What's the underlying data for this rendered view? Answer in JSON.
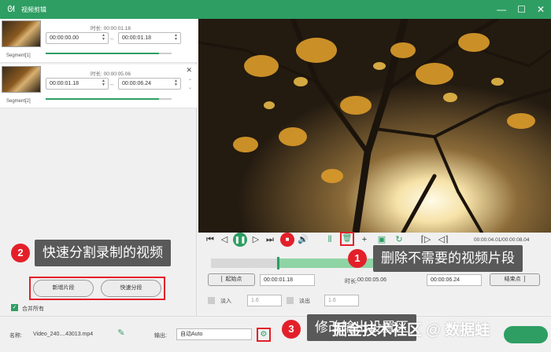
{
  "window": {
    "title": "视频剪辑",
    "controls": [
      "—",
      "☐",
      "✕"
    ]
  },
  "segments": [
    {
      "label": "Segment[1]",
      "duration_label": "时长:",
      "duration": "00:00:01.18",
      "start": "00:00:00.00",
      "end": "00:00:01.18",
      "progress": 0.9
    },
    {
      "label": "Segment[2]",
      "duration_label": "时长:",
      "duration": "00:00:05.06",
      "start": "00:00:01.18",
      "end": "00:00:06.24",
      "progress": 0.9
    }
  ],
  "callouts": {
    "c1": {
      "num": "1",
      "text": "删除不需要的视频片段"
    },
    "c2": {
      "num": "2",
      "text": "快速分割录制的视频"
    },
    "c3": {
      "num": "3",
      "text": "修改输出设置区"
    }
  },
  "left_buttons": {
    "new_segment": "新增片段",
    "quick_split": "快速分段",
    "merge_all": "合并所有"
  },
  "player": {
    "time": "00:00:04.01/00:00:08.04"
  },
  "trim": {
    "start_label": "起始点",
    "start_value": "00:00:01.18",
    "duration_label": "时长:",
    "duration_value": "00:00:05.06",
    "end_value": "00:00:06.24",
    "end_label": "结束点",
    "fade_in_label": "淡入",
    "fade_in_value": "1.6",
    "fade_out_label": "淡出",
    "fade_out_value": "1.6"
  },
  "bottom": {
    "name_label": "名称:",
    "file_name": "Video_240....43013.mp4",
    "output_label": "输出:",
    "output_value": "自动Auto"
  },
  "watermark": "掘金技术社区 @ 数据蛙",
  "colors": {
    "accent": "#2e9e63",
    "highlight": "#e3202a"
  }
}
